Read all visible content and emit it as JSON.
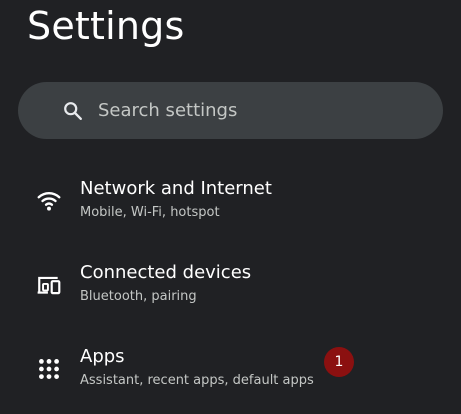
{
  "header": {
    "title": "Settings"
  },
  "search": {
    "placeholder": "Search settings",
    "icon": "search-icon"
  },
  "items": [
    {
      "title": "Network and Internet",
      "subtitle": "Mobile, Wi-Fi, hotspot",
      "icon": "wifi-icon"
    },
    {
      "title": "Connected devices",
      "subtitle": "Bluetooth, pairing",
      "icon": "connected-devices-icon"
    },
    {
      "title": "Apps",
      "subtitle": "Assistant, recent apps, default apps",
      "icon": "apps-grid-icon"
    }
  ],
  "badge": {
    "label": "1",
    "color": "#8b1010"
  },
  "colors": {
    "background": "#202124",
    "search_background": "#3c4043",
    "primary_text": "#ffffff",
    "secondary_text": "#c4c7c5"
  }
}
